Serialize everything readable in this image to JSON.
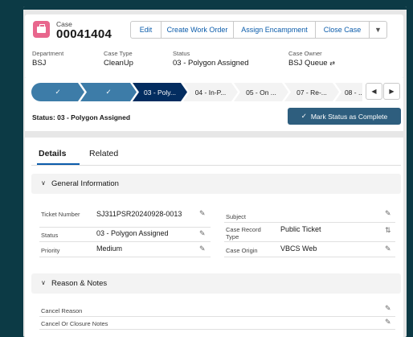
{
  "header": {
    "object_label": "Case",
    "record_number": "00041404",
    "actions": [
      "Edit",
      "Create Work Order",
      "Assign Encampment",
      "Close Case"
    ],
    "more_icon": "chevron-down-icon",
    "fields": [
      {
        "label": "Department",
        "value": "BSJ"
      },
      {
        "label": "Case Type",
        "value": "CleanUp"
      },
      {
        "label": "Status",
        "value": "03 - Polygon Assigned"
      },
      {
        "label": "Case Owner",
        "value": "BSJ Queue"
      }
    ]
  },
  "path": {
    "stages": [
      {
        "label": "✓",
        "state": "complete"
      },
      {
        "label": "✓",
        "state": "complete"
      },
      {
        "label": "03 - Poly...",
        "state": "current"
      },
      {
        "label": "04 - In-P...",
        "state": "incomplete"
      },
      {
        "label": "05 - On ...",
        "state": "incomplete"
      },
      {
        "label": "07 - Re-...",
        "state": "incomplete"
      },
      {
        "label": "08 - ...",
        "state": "incomplete"
      }
    ],
    "status_text": "Status: 03 - Polygon Assigned",
    "mark_complete_label": "Mark Status as Complete"
  },
  "tabs": {
    "details": "Details",
    "related": "Related"
  },
  "general_info": {
    "title": "General Information",
    "left": [
      {
        "label": "Ticket Number",
        "value": "SJ311PSR20240928-0013"
      },
      {
        "label": "Status",
        "value": "03 - Polygon Assigned"
      },
      {
        "label": "Priority",
        "value": "Medium"
      }
    ],
    "right": [
      {
        "label": "Subject",
        "value": ""
      },
      {
        "label": "Case Record Type",
        "value": "Public Ticket"
      },
      {
        "label": "Case Origin",
        "value": "VBCS Web"
      }
    ]
  },
  "reason_notes": {
    "title": "Reason & Notes",
    "fields": [
      {
        "label": "Cancel Reason",
        "value": ""
      },
      {
        "label": "Cancel Or Closure Notes",
        "value": ""
      }
    ]
  },
  "colors": {
    "path_complete": "#3d7ca8",
    "path_current": "#032d60",
    "brand_button": "#2e5e7e",
    "case_icon": "#e8668d",
    "background": "#0c3a45"
  }
}
